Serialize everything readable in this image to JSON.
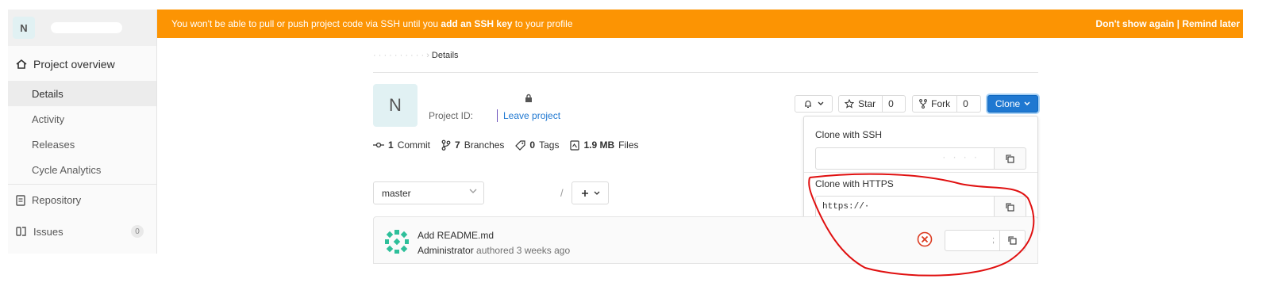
{
  "sidebar": {
    "avatar_letter": "N",
    "overview_label": "Project overview",
    "sub_items": [
      {
        "label": "Details",
        "active": true
      },
      {
        "label": "Activity",
        "active": false
      },
      {
        "label": "Releases",
        "active": false
      },
      {
        "label": "Cycle Analytics",
        "active": false
      }
    ],
    "repository_label": "Repository",
    "issues_label": "Issues",
    "issues_count": "0"
  },
  "banner": {
    "text_before": "You won't be able to pull or push project code via SSH until you ",
    "link_text": "add an SSH key",
    "text_after": " to your profile",
    "dont_show": "Don't show again",
    "divider": " | ",
    "remind": "Remind later"
  },
  "breadcrumb": {
    "current": "Details"
  },
  "project": {
    "avatar_letter": "N",
    "id_label": "Project ID:",
    "leave_label": "Leave project"
  },
  "stats": {
    "commits_count": "1",
    "commits_label": "Commit",
    "branches_count": "7",
    "branches_label": "Branches",
    "tags_count": "0",
    "tags_label": "Tags",
    "files_size": "1.9 MB",
    "files_label": "Files"
  },
  "actions": {
    "star_label": "Star",
    "star_count": "0",
    "fork_label": "Fork",
    "fork_count": "0",
    "clone_label": "Clone"
  },
  "clone_dropdown": {
    "ssh_title": "Clone with SSH",
    "https_title": "Clone with HTTPS",
    "https_value": "https://·"
  },
  "branch": {
    "selected": "master"
  },
  "commit": {
    "title": "Add README.md",
    "author": "Administrator",
    "meta": "authored 3 weeks ago"
  },
  "colors": {
    "banner": "#fc9403",
    "accent": "#1f78d1",
    "annotation": "#e01010"
  }
}
